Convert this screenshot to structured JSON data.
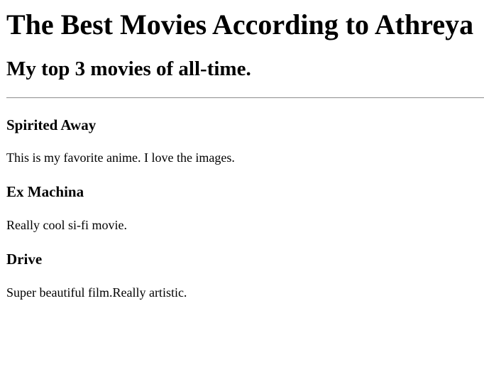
{
  "page": {
    "title": "The Best Movies According to Athreya",
    "subtitle": "My top 3 movies of all-time."
  },
  "movies": [
    {
      "name": "Spirited Away",
      "description": "This is my favorite anime. I love the images."
    },
    {
      "name": "Ex Machina",
      "description": "Really cool si-fi movie."
    },
    {
      "name": "Drive",
      "description": "Super beautiful film.Really artistic."
    }
  ]
}
